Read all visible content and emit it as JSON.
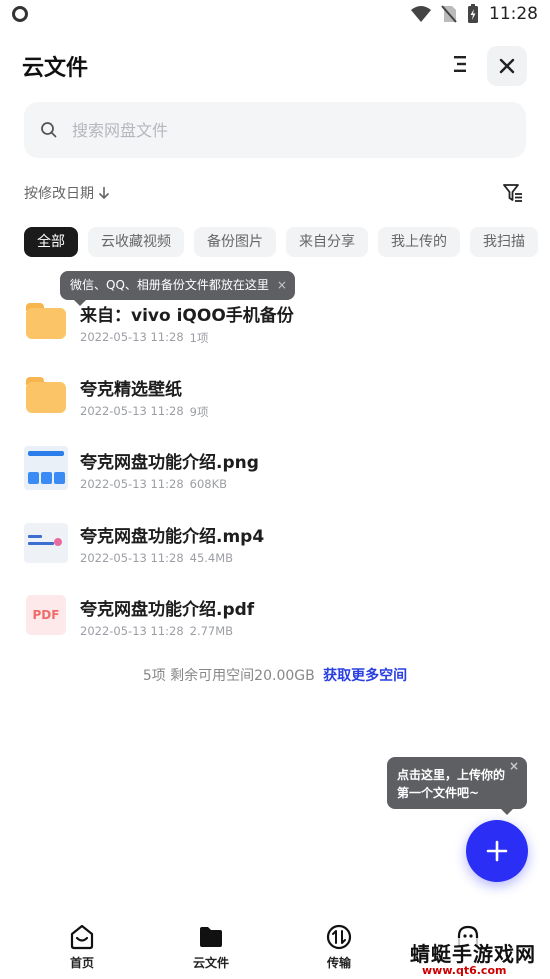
{
  "status_bar": {
    "time": "11:28"
  },
  "header": {
    "title": "云文件"
  },
  "search": {
    "placeholder": "搜索网盘文件"
  },
  "sort": {
    "label": "按修改日期"
  },
  "chips": [
    "全部",
    "云收藏视频",
    "备份图片",
    "来自分享",
    "我上传的",
    "我扫描"
  ],
  "tooltip_top": {
    "text": "微信、QQ、相册备份文件都放在这里"
  },
  "files": [
    {
      "name": "来自：vivo iQOO手机备份",
      "date": "2022-05-13 11:28",
      "info": "1项",
      "icon": "folder-icon"
    },
    {
      "name": "夸克精选壁纸",
      "date": "2022-05-13 11:28",
      "info": "9项",
      "icon": "folder-icon"
    },
    {
      "name": "夸克网盘功能介绍.png",
      "date": "2022-05-13 11:28",
      "info": "608KB",
      "icon": "image-thumbnail"
    },
    {
      "name": "夸克网盘功能介绍.mp4",
      "date": "2022-05-13 11:28",
      "info": "45.4MB",
      "icon": "video-thumbnail"
    },
    {
      "name": "夸克网盘功能介绍.pdf",
      "date": "2022-05-13 11:28",
      "info": "2.77MB",
      "icon": "pdf-icon",
      "thumb_label": "PDF"
    }
  ],
  "storage": {
    "text": "5项 剩余可用空间20.00GB",
    "link": "获取更多空间"
  },
  "tooltip_fab": {
    "line1": "点击这里，上传你的",
    "line2": "第一个文件吧~"
  },
  "nav": [
    {
      "label": "首页",
      "icon": "home-icon"
    },
    {
      "label": "云文件",
      "icon": "cloud-folder-icon"
    },
    {
      "label": "传输",
      "icon": "transfer-icon"
    }
  ],
  "watermark": {
    "name": "蜻蜓手游戏网",
    "url": "www.qt6.com"
  },
  "colors": {
    "accent": "#2b2ff5",
    "link": "#2a3fe0",
    "folder": "#fbc466",
    "active_chip": "#1b1b1b"
  }
}
